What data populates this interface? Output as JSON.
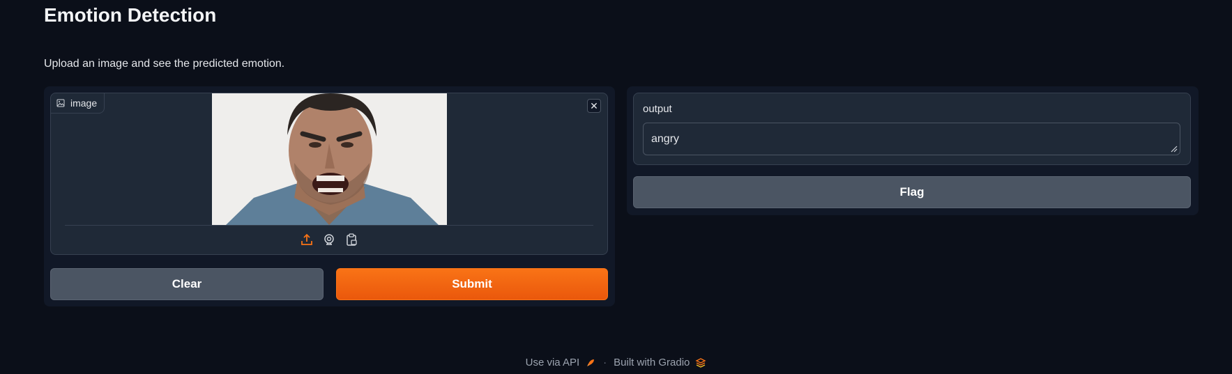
{
  "header": {
    "title": "Emotion Detection",
    "description": "Upload an image and see the predicted emotion."
  },
  "input": {
    "image_label": "image",
    "image_icon": "image-icon",
    "close_symbol": "✕",
    "sources": [
      "upload-icon",
      "webcam-icon",
      "clipboard-icon"
    ]
  },
  "buttons": {
    "clear": "Clear",
    "submit": "Submit",
    "flag": "Flag"
  },
  "output": {
    "label": "output",
    "value": "angry"
  },
  "footer": {
    "api": "Use via API",
    "separator": "·",
    "built_with": "Built with Gradio"
  },
  "colors": {
    "background": "#0b0f19",
    "panel": "#111827",
    "block": "#1f2937",
    "accent": "#f97316",
    "secondary_button": "#4b5563"
  }
}
